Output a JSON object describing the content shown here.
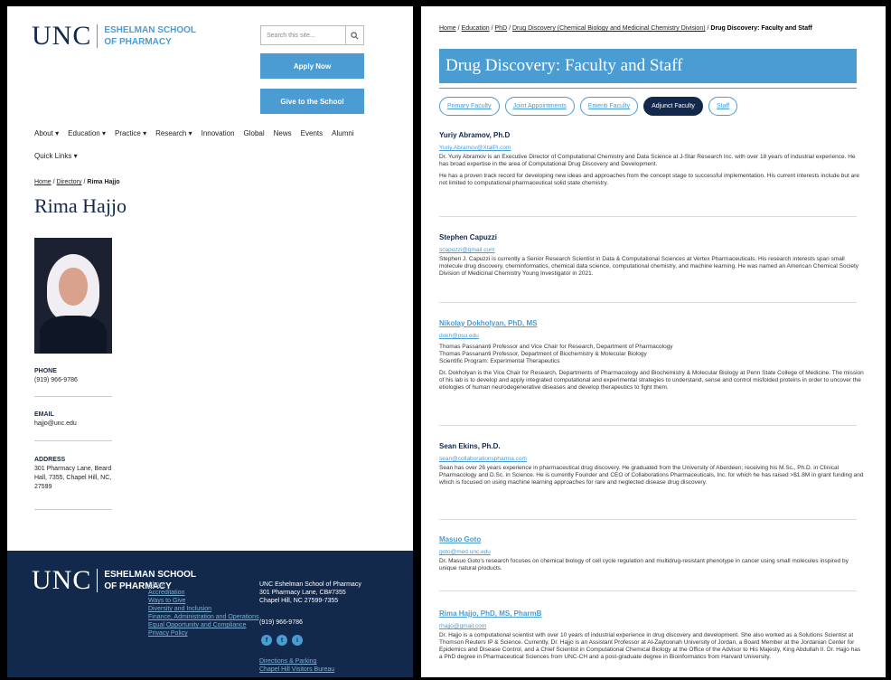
{
  "left": {
    "logo_word": "UNC",
    "school_line1": "ESHELMAN SCHOOL",
    "school_line2": "OF PHARMACY",
    "search_placeholder": "Search this site...",
    "search_icon": "magnifier",
    "apply": "Apply Now",
    "give": "Give to the School",
    "nav": [
      "About ▾",
      "Education ▾",
      "Practice ▾",
      "Research ▾",
      "Innovation",
      "Global",
      "News",
      "Events",
      "Alumni"
    ],
    "quick_links": "Quick Links ▾",
    "breadcrumb": {
      "home": "Home",
      "sep": " / ",
      "directory": "Directory",
      "current": "Rima Hajjo"
    },
    "name": "Rima Hajjo",
    "phone_label": "PHONE",
    "phone": "(919) 966-9786",
    "email_label": "EMAIL",
    "email": "hajjo@unc.edu",
    "address_label": "ADDRESS",
    "address": "301 Pharmacy Lane, Beard Hall, 7355, Chapel Hill, NC, 27599",
    "footer": {
      "logo_word": "UNC",
      "school_line1": "ESHELMAN SCHOOL",
      "school_line2": "OF PHARMACY",
      "links": [
        "About",
        "Accreditation",
        "Ways to Give",
        "Diversity and Inclusion",
        "Finance, Administration and Operations",
        "Equal Opportunity and Compliance",
        "Privacy Policy"
      ],
      "address_lines": [
        "UNC Eshelman School of Pharmacy",
        "301 Pharmacy Lane, CB#7355",
        "Chapel Hill, NC 27599-7355"
      ],
      "phone": "(919) 966-9786",
      "social": [
        "f",
        "t",
        "i"
      ],
      "links2": [
        "Directions & Parking",
        "Chapel Hill Visitors Bureau"
      ]
    }
  },
  "right": {
    "breadcrumb": {
      "home": "Home",
      "education": "Education",
      "phd": "PhD",
      "division": "Drug Discovery (Chemical Biology and Medicinal Chemistry Division)",
      "current": "Drug Discovery: Faculty and Staff"
    },
    "title": "Drug Discovery: Faculty and Staff",
    "tabs": [
      "Primary Faculty",
      "Joint Appointments",
      "Emeriti Faculty",
      "Adjunct Faculty",
      "Staff"
    ],
    "active_tab": "Adjunct Faculty",
    "people": [
      {
        "name": "Yuriy Abramov, Ph.D",
        "email": "Yuriy.Abramov@XtalPi.com",
        "paras": [
          "Dr. Yuriy Abramov is an Executive Director of Computational Chemistry and Data Science at J-Star Research Inc. with over 18 years of industrial experience.  He has broad expertise in the area of Computational Drug Discovery and Development.",
          "He has a proven track record for developing new ideas and approaches from the concept stage to successful implementation. His current interests include but are not limited to computational pharmaceutical solid state chemistry."
        ]
      },
      {
        "name": "Stephen Capuzzi",
        "email": "scapuzzi@gmail.com",
        "paras": [
          "Stephen J. Capuzzi is currently a Senior Research Scientist in Data & Computational Sciences at Vertex Pharmaceuticals. His research interests span small molecule drug discovery, cheminformatics, chemical data science, computational chemistry, and machine learning. He was named an American Chemical Society Division of Medicinal Chemistry Young Investigator in 2021."
        ]
      },
      {
        "name": "Nikolay Dokholyan, PhD, MS",
        "email": "dokh@psu.edu",
        "roles": [
          "Thomas Passananti Professor and Vice Chair for Research, Department of Pharmacology",
          "Thomas Passananti Professor, Department of Biochemistry & Molecular Biology",
          "Scientific Program: Experimental Therapeutics"
        ],
        "paras": [
          "Dr. Dokholyan is the Vice Chair for Research, Departments of Pharmacology and Biochemistry & Molecular Biology at Penn State College of Medicine. The mission of his lab is to develop and apply integrated computational and experimental strategies to understand, sense and control misfolded proteins in order to uncover the etiologies of human neurodegenerative diseases and develop therapeutics to fight them."
        ]
      },
      {
        "name": "Sean Ekins, Ph.D.",
        "email": "sean@collaborationspharma.com",
        "paras": [
          "Sean has over 26 years experience in pharmaceutical drug discovery. He graduated from the University of Aberdeen; receiving his M.Sc., Ph.D. in Clinical Pharmacology and D.Sc. in Science. He is currently Founder and CEO of Collaborations Pharmaceuticals, Inc. for which he has raised >$1.8M in grant funding and which is focused on using machine learning approaches for rare and neglected disease drug discovery."
        ]
      },
      {
        "name": "Masuo Goto",
        "email": "goto@med.unc.edu",
        "paras": [
          "Dr. Masuo Goto's research focuses on chemical biology of cell cycle regulation and multidrug-resistant phenotype in cancer using small molecules inspired by unique natural products."
        ]
      },
      {
        "name": "Rima Hajjo, PhD, MS, PharmB",
        "email": "rhajjo@gmail.com",
        "paras": [
          "Dr. Hajjo is a computational scientist with over 10 years of industrial experience in drug discovery and development. She also worked as a Solutions Scientist at Thomson Reuters IP & Science. Currently, Dr. Hajjo is an Assistant Professor at Al-Zaytoonah University of Jordan, a Board Member at the Jordanian Center for Epidemics and Disease Control, and a Chief Scientist in Computational Chemical Biology at the Office of the Advisor to His Majesty, King Abdullah II. Dr. Hajjo has a PhD degree in Pharmaceutical Sciences from UNC-CH and a post-graduate degree in Bioinformatics from Harvard University."
        ]
      }
    ]
  },
  "colors": {
    "navy": "#13294b",
    "carolina_blue": "#4b9cd3",
    "frame": "#000000"
  }
}
